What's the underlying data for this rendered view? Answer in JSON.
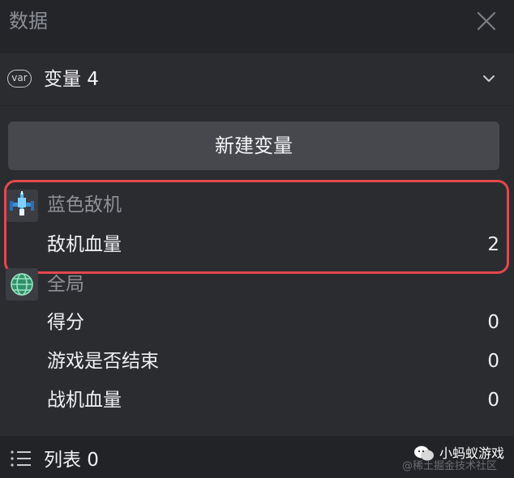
{
  "header": {
    "title": "数据"
  },
  "variables_section": {
    "badge": "var",
    "title": "变量 4"
  },
  "new_variable_button": {
    "label": "新建变量"
  },
  "groups": [
    {
      "title": "蓝色敌机",
      "icon": "blue-enemy-plane-icon",
      "rows": [
        {
          "label": "敌机血量",
          "value": "2"
        }
      ]
    },
    {
      "title": "全局",
      "icon": "globe-icon",
      "rows": [
        {
          "label": "得分",
          "value": "0"
        },
        {
          "label": "游戏是否结束",
          "value": "0"
        },
        {
          "label": "战机血量",
          "value": "0"
        }
      ]
    }
  ],
  "lists_section": {
    "title": "列表 0"
  },
  "watermark": {
    "label": "小蚂蚁游戏",
    "sub": "@稀土掘金技术社区"
  },
  "colors": {
    "highlight": "#e2484d",
    "background": "#2b2c30",
    "button": "#47484e"
  }
}
